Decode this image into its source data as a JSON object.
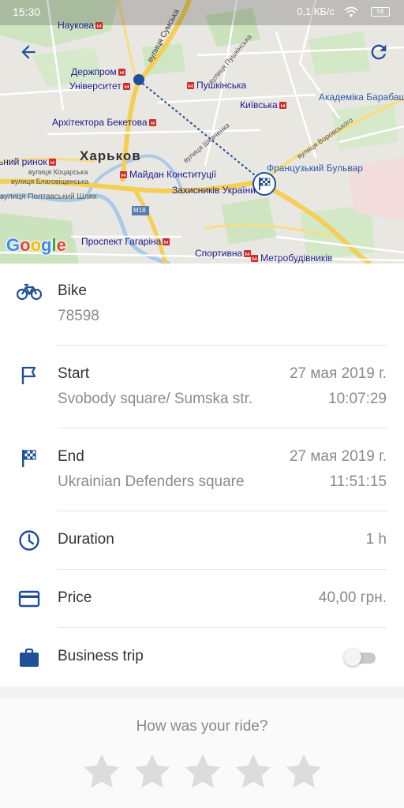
{
  "status_bar": {
    "time": "15:30",
    "network_speed": "0,1 КБ/с",
    "battery": "58"
  },
  "map": {
    "labels": {
      "naukova": "Наукова",
      "derzhprom": "Держпром",
      "universytet": "Університет",
      "pushkinska": "Пушкінська",
      "kyivska": "Київська",
      "akademika": "Академіка Барабашова",
      "beketova": "Архітектора Бекетова",
      "kharkov": "Харьков",
      "rynok": "Центральний ринок",
      "maidan": "Майдан Конституції",
      "frantsuzkyi": "Французький Бульвар",
      "zakhysnykiv": "Захисників України",
      "poltavskyi": "вулиця Полтавський Шлях",
      "m18": "M18",
      "haharina": "Проспект Гагаріна",
      "sportyvna": "Спортивна",
      "metrobudivnykiv": "Метробудівників",
      "sumska": "вулиця Сумська",
      "pushkinska_st": "вулиця Пушкінська",
      "shevchenka_st": "вулиця Шевченка",
      "kotsarska_st": "вулиця Коцарська",
      "blahovishchenska_st": "вулиця Благовіщенська",
      "vorovskoho_st": "вулиця Воровського",
      "google": "Google"
    }
  },
  "ride": {
    "bike": {
      "label": "Bike",
      "number": "78598"
    },
    "start": {
      "label": "Start",
      "location": "Svobody square/ Sumska str.",
      "date": "27 мая 2019 г.",
      "time": "10:07:29"
    },
    "end": {
      "label": "End",
      "location": "Ukrainian Defenders square",
      "date": "27 мая 2019 г.",
      "time": "11:51:15"
    },
    "duration": {
      "label": "Duration",
      "value": "1 h"
    },
    "price": {
      "label": "Price",
      "value": "40,00 грн."
    },
    "business_trip": {
      "label": "Business trip",
      "enabled": false
    }
  },
  "rating": {
    "question": "How was your ride?",
    "stars_total": 5,
    "stars_selected": 0
  },
  "colors": {
    "accent": "#1f4f99",
    "text_primary": "#333333",
    "text_secondary": "#8a8a8a",
    "star_empty": "#dcdcdc"
  },
  "icons": [
    "back-arrow-icon",
    "refresh-icon",
    "bicycle-icon",
    "flag-icon",
    "checkered-flag-icon",
    "clock-icon",
    "credit-card-icon",
    "briefcase-icon",
    "star-icon"
  ]
}
